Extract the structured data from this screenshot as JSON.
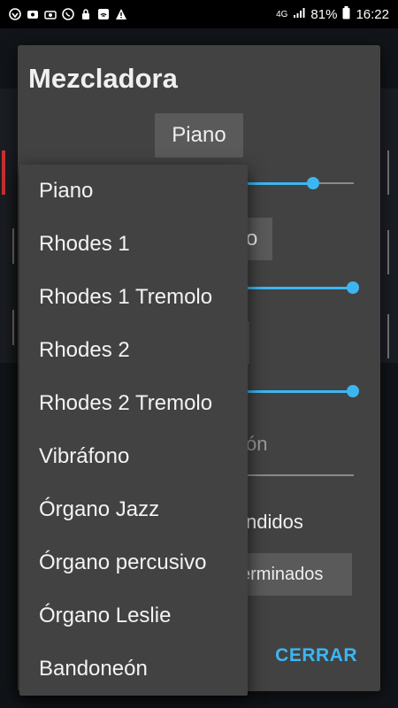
{
  "status": {
    "network": "4G",
    "battery": "81%",
    "time": "16:22"
  },
  "dialog": {
    "title": "Mezcladora",
    "instrument_button": "Piano",
    "partial_button": "o",
    "partial_text": "ón",
    "partial_label": "ndidos",
    "partial_button2": "erminados",
    "close_button": "CERRAR"
  },
  "dropdown": {
    "items": [
      "Piano",
      "Rhodes 1",
      "Rhodes 1 Tremolo",
      "Rhodes 2",
      "Rhodes 2 Tremolo",
      "Vibráfono",
      "Órgano Jazz",
      "Órgano percusivo",
      "Órgano Leslie",
      "Bandoneón"
    ]
  },
  "sliders": {
    "slider1": 0.7,
    "slider2": 1.0,
    "slider3": 1.0
  },
  "colors": {
    "accent": "#3cb6f0",
    "dialog_bg": "#424242"
  }
}
